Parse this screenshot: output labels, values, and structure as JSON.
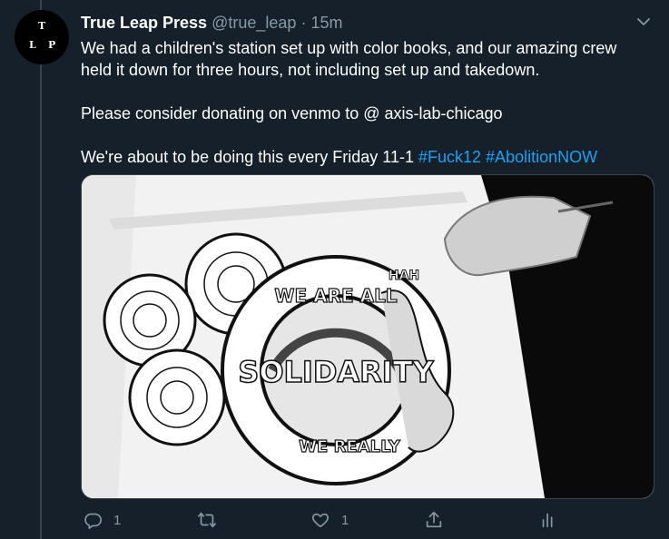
{
  "tweet": {
    "avatar_letters": [
      "T",
      "L",
      "P"
    ],
    "display_name": "True Leap Press",
    "handle": "@true_leap",
    "separator": "·",
    "time": "15m",
    "paragraph1": "We had a children's station set up with color books, and our amazing crew held it down for three hours, not including set up and takedown.",
    "paragraph2": "Please consider donating on venmo to  @ axis-lab-chicago",
    "paragraph3_text": "We're about to be doing this every Friday 11-1 ",
    "hashtags": [
      "#Fuck12",
      "#AbolitionNOW"
    ],
    "media": {
      "arc_top": "WE ARE ALL",
      "center": "SOLIDARITY",
      "arc_bottom": "WE REALLY",
      "ribbon_top": "HAH"
    }
  },
  "actions": {
    "reply_count": "1",
    "retweet_count": "",
    "like_count": "1"
  },
  "icons": {
    "more": "chevron-down-icon",
    "reply": "reply-icon",
    "retweet": "retweet-icon",
    "like": "heart-icon",
    "share": "share-icon",
    "analytics": "analytics-icon"
  },
  "colors": {
    "background": "#15202b",
    "secondary_text": "#8899a6",
    "link": "#1da1f2",
    "divider": "#38444d"
  }
}
